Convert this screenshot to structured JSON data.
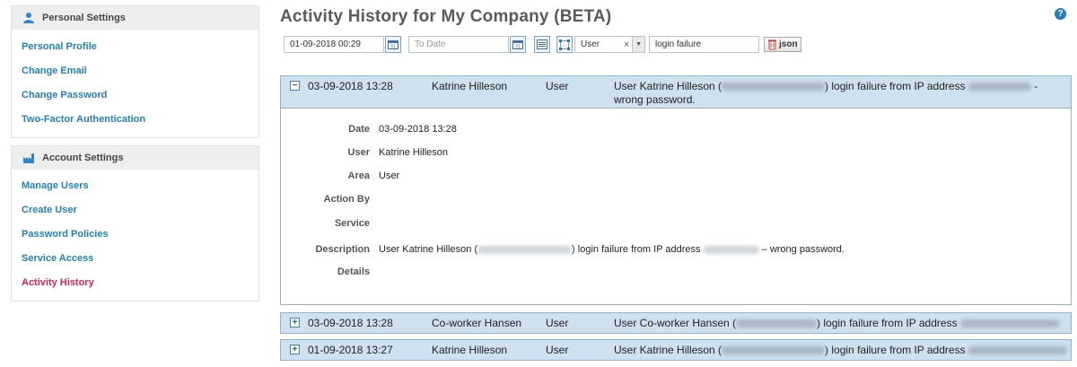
{
  "sidebar": {
    "personal": {
      "title": "Personal Settings",
      "icon": "user-icon",
      "items": [
        "Personal Profile",
        "Change Email",
        "Change Password",
        "Two-Factor Authentication"
      ]
    },
    "account": {
      "title": "Account Settings",
      "icon": "factory-icon",
      "items": [
        "Manage Users",
        "Create User",
        "Password Policies",
        "Service Access",
        "Activity History"
      ],
      "active": "Activity History"
    }
  },
  "page": {
    "title": "Activity History for My Company (BETA)",
    "help": "?"
  },
  "filters": {
    "from_date": "01-09-2018 00:29",
    "to_date_placeholder": "To Date",
    "area": "User",
    "search": "login failure",
    "json_label": "json"
  },
  "rows": [
    {
      "toggle": "−",
      "datetime": "03-09-2018 13:28",
      "user": "Katrine Hilleson",
      "area": "User",
      "desc_prefix": "User Katrine Hilleson (",
      "desc_mid": ") login failure from IP address",
      "desc_suffix": " -",
      "desc_line2": "wrong password."
    },
    {
      "toggle": "+",
      "datetime": "03-09-2018 13:28",
      "user": "Co-worker Hansen",
      "area": "User",
      "desc_prefix": "User Co-worker Hansen (",
      "desc_mid": ") login failure from IP address"
    },
    {
      "toggle": "+",
      "datetime": "01-09-2018 13:27",
      "user": "Katrine Hilleson",
      "area": "User",
      "desc_prefix": "User Katrine Hilleson (",
      "desc_mid": ") login failure from IP address"
    }
  ],
  "detail": {
    "labels": {
      "date": "Date",
      "user": "User",
      "area": "Area",
      "action_by": "Action By",
      "service": "Service",
      "description": "Description",
      "details": "Details"
    },
    "date": "03-09-2018 13:28",
    "user": "Katrine Hilleson",
    "area": "User",
    "action_by": "",
    "service": "",
    "desc_prefix": "User Katrine Hilleson (",
    "desc_mid": ") login failure from IP address",
    "desc_suffix": " – wrong password.",
    "details": ""
  },
  "colors": {
    "link": "#1f7fc1",
    "active_link": "#d61f57",
    "row_bg": "#cfe0ee"
  }
}
